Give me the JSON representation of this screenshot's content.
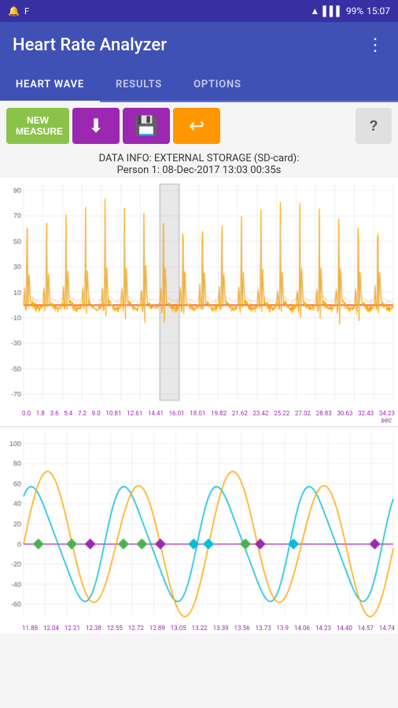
{
  "status_bar": {
    "left_icons": [
      "notification",
      "f-icon"
    ],
    "time": "15:07",
    "battery": "99%",
    "wifi": "wifi",
    "signal": "signal"
  },
  "app_bar": {
    "title": "Heart Rate Analyzer",
    "menu_icon": "⋮"
  },
  "tabs": [
    {
      "label": "HEART WAVE",
      "active": true
    },
    {
      "label": "RESULTS",
      "active": false
    },
    {
      "label": "OPTIONS",
      "active": false
    }
  ],
  "toolbar": {
    "new_measure_label": "NEW\nMEASURE",
    "download_icon": "⬇",
    "save_icon": "💾",
    "undo_icon": "↩",
    "help_label": "?"
  },
  "data_info": {
    "line1": "DATA INFO: EXTERNAL STORAGE (SD-card):",
    "line2": "Person 1: 08-Dec-2017 13:03 00:35s"
  },
  "chart1": {
    "y_labels": [
      "90",
      "70",
      "50",
      "30",
      "10",
      "-10",
      "-30",
      "-50",
      "-70"
    ],
    "x_labels": [
      "0.0",
      "1.8",
      "3.6",
      "5.4",
      "7.2",
      "9.0",
      "10.81",
      "12.61",
      "14.41",
      "16.01",
      "18.01",
      "19.82",
      "21.62",
      "23.42",
      "25.22",
      "27.02",
      "28.83",
      "30.63",
      "32.43",
      "34.23"
    ],
    "sec_label": "sec"
  },
  "chart2": {
    "y_labels": [
      "100",
      "80",
      "60",
      "40",
      "20",
      "0",
      "-20",
      "-40",
      "-60"
    ],
    "x_labels": [
      "11.88",
      "12.04",
      "12.21",
      "12.38",
      "12.55",
      "12.72",
      "12.89",
      "13.05",
      "13.22",
      "13.39",
      "13.56",
      "13.73",
      "13.9",
      "14.06",
      "14.23",
      "14.40",
      "14.57",
      "14.74"
    ]
  },
  "colors": {
    "primary": "#3f51b5",
    "tab_active": "#ffffff",
    "green_btn": "#8bc34a",
    "purple_btn": "#9c27b0",
    "orange_btn": "#ff9800",
    "wave_orange": "#FFA500",
    "wave_cyan": "#00BCD4",
    "zero_line": "#e53935",
    "zero_line2": "#9c27b0",
    "grid": "#e0e0e0",
    "marker_purple": "#9c27b0",
    "marker_green": "#4caf50",
    "marker_cyan": "#00BCD4"
  }
}
